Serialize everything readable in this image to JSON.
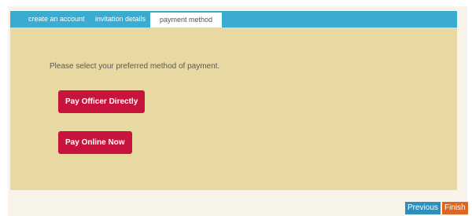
{
  "tabs": [
    {
      "label": "create an account"
    },
    {
      "label": "invitation details"
    },
    {
      "label": "payment method"
    }
  ],
  "content": {
    "instruction": "Please select your preferred method of payment.",
    "pay_officer_label": "Pay Officer Directly",
    "pay_online_label": "Pay Online Now"
  },
  "nav": {
    "previous_label": "Previous",
    "finish_label": "Finish"
  },
  "colors": {
    "tab_bar": "#3aabd2",
    "content_bg": "#e8d8a1",
    "pay_button": "#c8143c",
    "previous_button": "#2c8fbf",
    "finish_button": "#e0661f"
  }
}
